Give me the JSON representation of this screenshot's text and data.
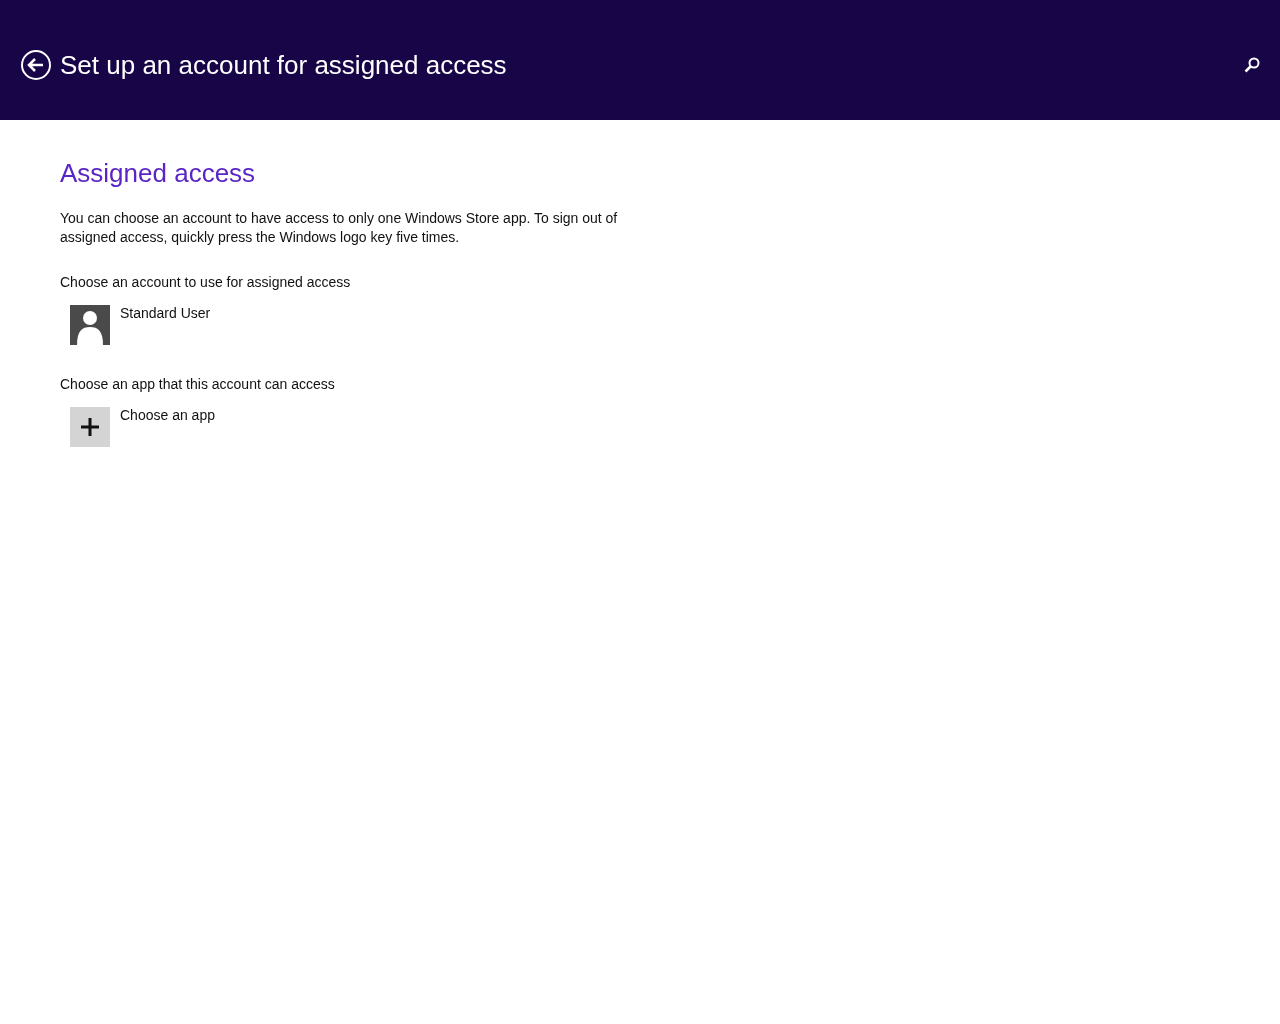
{
  "header": {
    "title": "Set up an account for assigned access"
  },
  "heading": "Assigned access",
  "description": "You can choose an account to have access to only one Windows Store app. To sign out of assigned access, quickly press the Windows logo key five times.",
  "sections": [
    {
      "label": "Choose an account to use for assigned access",
      "item": {
        "kind": "account",
        "name": "Standard User"
      }
    },
    {
      "label": "Choose an app that this account can access",
      "item": {
        "kind": "add",
        "name": "Choose an app"
      }
    }
  ]
}
